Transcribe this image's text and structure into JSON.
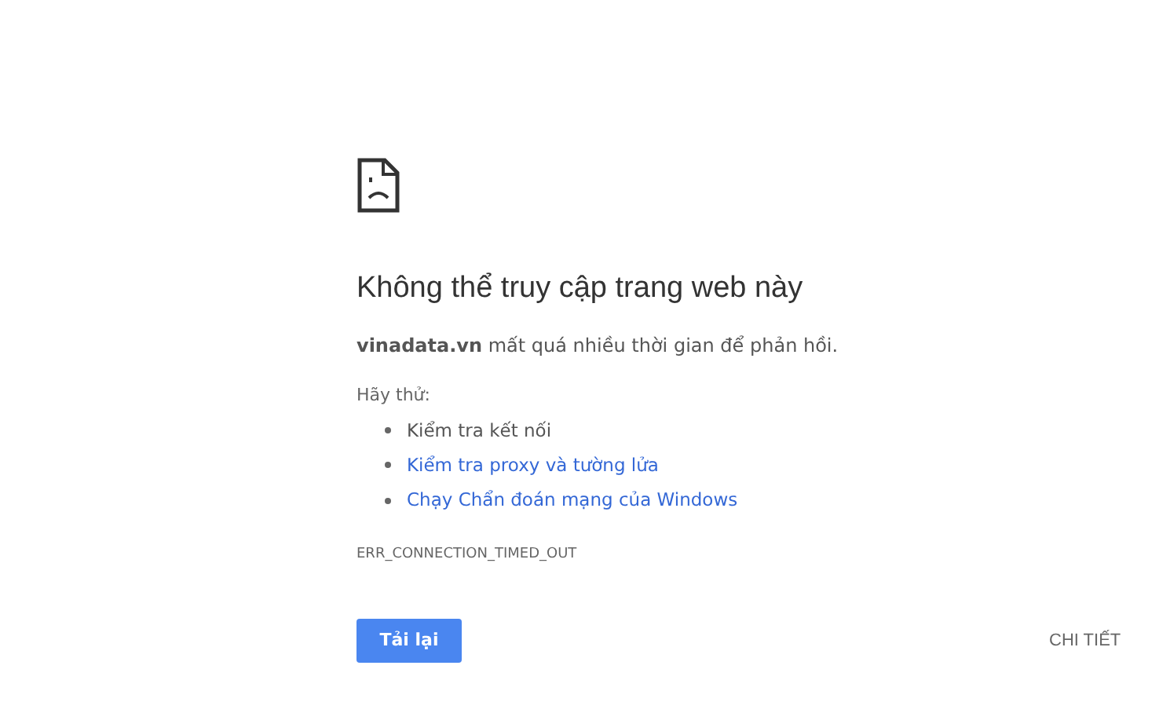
{
  "title": "Không thể truy cập trang web này",
  "message": "**vinadata.vn** mất quá nhiều thời gian để phản hồi.",
  "suggestions_heading": "Hãy thử:",
  "suggestions": [
    {
      "kind": "text",
      "label": "Kiểm tra kết nối"
    },
    {
      "kind": "link",
      "label": "Kiểm tra proxy và tường lửa"
    },
    {
      "kind": "link",
      "label": "Chạy Chẩn đoán mạng của Windows"
    }
  ],
  "error_code": "ERR_CONNECTION_TIMED_OUT",
  "buttons": {
    "reload": "Tải lại",
    "details": "CHI TIẾT"
  }
}
